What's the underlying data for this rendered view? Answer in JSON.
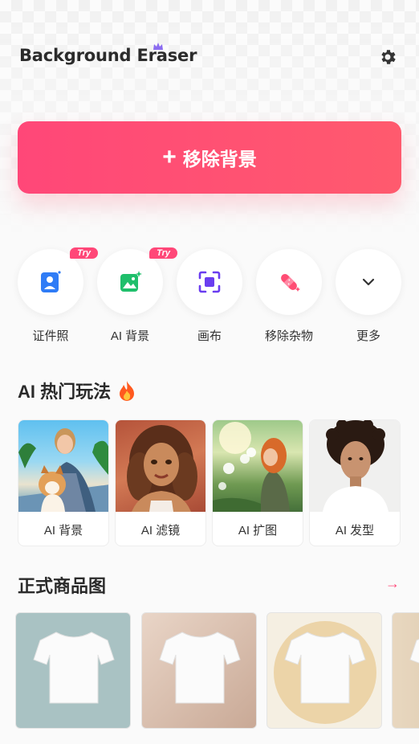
{
  "header": {
    "app_title": "Background Eraser",
    "settings_icon": "gear-icon"
  },
  "main_action": {
    "label": "移除背景",
    "icon": "plus-icon",
    "color": "#ff4d74"
  },
  "tools": [
    {
      "label": "证件照",
      "icon": "id-photo-icon",
      "badge": "Try",
      "color": "#2f7cf6"
    },
    {
      "label": "AI 背景",
      "icon": "image-sparkle-icon",
      "badge": "Try",
      "color": "#1fbf6b"
    },
    {
      "label": "画布",
      "icon": "crop-frame-icon",
      "badge": "",
      "color": "#6a3df0"
    },
    {
      "label": "移除杂物",
      "icon": "bandage-icon",
      "badge": "",
      "color": "#ff4d74"
    },
    {
      "label": "更多",
      "icon": "chevron-down-icon",
      "badge": "",
      "color": "#333333"
    }
  ],
  "hot_section": {
    "title": "AI 热门玩法",
    "icon": "fire-icon",
    "cards": [
      {
        "label": "AI 背景"
      },
      {
        "label": "AI 滤镜"
      },
      {
        "label": "AI 扩图"
      },
      {
        "label": "AI 发型"
      }
    ]
  },
  "products_section": {
    "title": "正式商品图",
    "more_icon": "arrow-right-icon"
  }
}
